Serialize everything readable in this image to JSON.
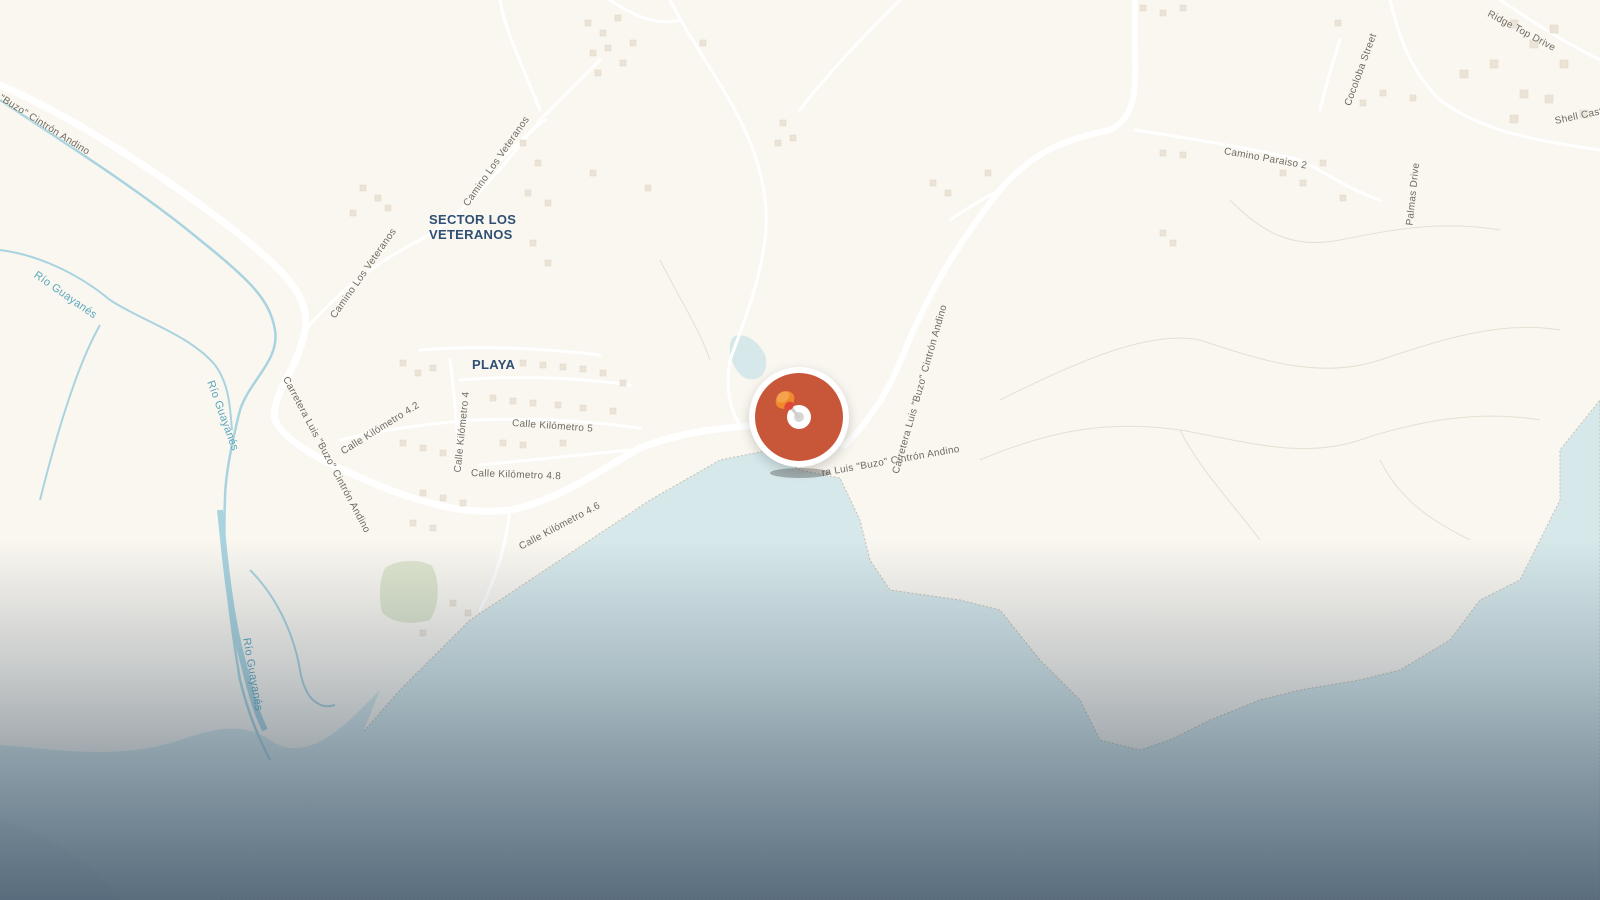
{
  "map": {
    "style": "light coastal basemap",
    "colors": {
      "land": "#faf7f0",
      "water": "#d6e8ea",
      "river": "#a9d3df",
      "road": "#ffffff",
      "park": "#dfe6cf",
      "building": "#ebe3d6",
      "marker": "#c8573a"
    }
  },
  "places": {
    "sector_line1": "SECTOR LOS",
    "sector_line2": "VETERANOS",
    "playa": "PLAYA"
  },
  "roads": {
    "carretera_top": "\"Buzo\" Cintrón Andino",
    "carretera_left": "Carretera Luis \"Buzo\" Cintrón Andino",
    "carretera_center": "ra Luis \"Buzo\" Cintrón Andino",
    "camino_veteranos_upper": "Camino Los Veteranos",
    "camino_veteranos_lower": "Camino Los Veteranos",
    "calle_km5": "Calle Kilómetro 5",
    "calle_km42": "Calle Kilómetro 4.2",
    "calle_km4": "Calle Kilómetro 4",
    "calle_km48": "Calle Kilómetro 4.8",
    "calle_km46": "Calle Kilómetro 4.6",
    "camino_paraiso": "Camino Paraiso 2",
    "cocoloba": "Cocoloba Street",
    "palmas": "Palmas Drive",
    "ridge_top": "Ridge Top Drive",
    "shell_castle": "Shell Castle"
  },
  "waterways": {
    "rio_upper": "Río Guayanés",
    "rio_middle": "Río Guayanés",
    "rio_lower": "Río Guayanés"
  },
  "marker": {
    "icon": "map-pin-icon"
  }
}
